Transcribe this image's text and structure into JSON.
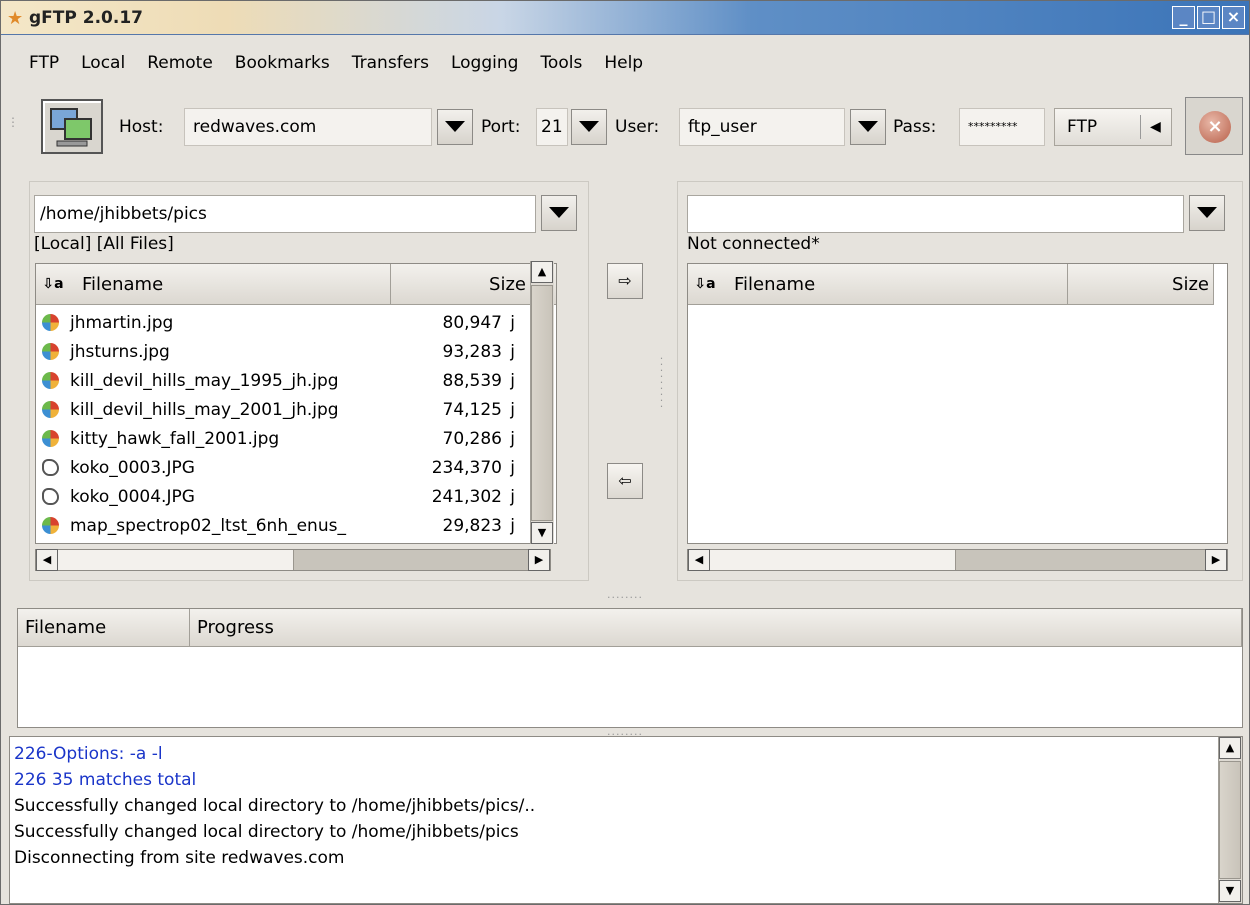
{
  "window": {
    "title": "gFTP 2.0.17"
  },
  "menubar": {
    "items": [
      "FTP",
      "Local",
      "Remote",
      "Bookmarks",
      "Transfers",
      "Logging",
      "Tools",
      "Help"
    ]
  },
  "toolbar": {
    "host_label": "Host:",
    "host_value": "redwaves.com",
    "port_label": "Port:",
    "port_value": "21",
    "user_label": "User:",
    "user_value": "ftp_user",
    "pass_label": "Pass:",
    "pass_value": "*********",
    "protocol": "FTP"
  },
  "local": {
    "path": "/home/jhibbets/pics",
    "status": "[Local] [All Files]",
    "columns": {
      "filename": "Filename",
      "size": "Size"
    },
    "files": [
      {
        "name": "jhmartin.jpg",
        "size": "80,947",
        "icon": "image-icon",
        "trail": "j"
      },
      {
        "name": "jhsturns.jpg",
        "size": "93,283",
        "icon": "image-icon",
        "trail": "j"
      },
      {
        "name": "kill_devil_hills_may_1995_jh.jpg",
        "size": "88,539",
        "icon": "image-icon",
        "trail": "j"
      },
      {
        "name": "kill_devil_hills_may_2001_jh.jpg",
        "size": "74,125",
        "icon": "image-icon",
        "trail": "j"
      },
      {
        "name": "kitty_hawk_fall_2001.jpg",
        "size": "70,286",
        "icon": "image-icon",
        "trail": "j"
      },
      {
        "name": "koko_0003.JPG",
        "size": "234,370",
        "icon": "file-icon",
        "trail": "j"
      },
      {
        "name": "koko_0004.JPG",
        "size": "241,302",
        "icon": "file-icon",
        "trail": "j"
      },
      {
        "name": "map_spectrop02_ltst_6nh_enus_",
        "size": "29,823",
        "icon": "image-icon",
        "trail": "j"
      }
    ]
  },
  "remote": {
    "path": "",
    "status": "Not connected*",
    "columns": {
      "filename": "Filename",
      "size": "Size"
    }
  },
  "transfers": {
    "columns": {
      "filename": "Filename",
      "progress": "Progress"
    }
  },
  "log": {
    "lines": [
      {
        "text": "226-Options: -a -l",
        "color": "#1a35c9"
      },
      {
        "text": "226 35 matches total",
        "color": "#1a35c9"
      },
      {
        "text": "Successfully changed local directory to /home/jhibbets/pics/..",
        "color": "#000000"
      },
      {
        "text": "Successfully changed local directory to /home/jhibbets/pics",
        "color": "#000000"
      },
      {
        "text": "Disconnecting from site redwaves.com",
        "color": "#000000"
      }
    ]
  }
}
